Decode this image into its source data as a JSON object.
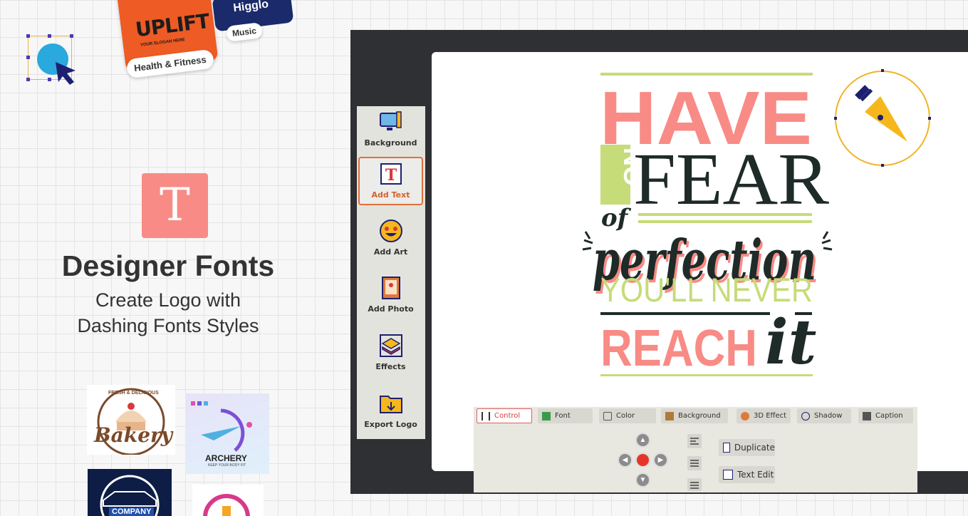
{
  "templates": {
    "uplift_text": "UPLIFT",
    "uplift_sub": "YOUR SLOGAN HERE",
    "health_tag": "Health & Fitness",
    "higglo_text": "Higglo",
    "music_tag": "Music"
  },
  "feature": {
    "icon_letter": "T",
    "title": "Designer Fonts",
    "subtitle_line1": "Create Logo with",
    "subtitle_line2": "Dashing Fonts Styles"
  },
  "samples": {
    "bakery_text": "Bakery",
    "bakery_arc": "FRESH & DELICIOUS",
    "archery_text": "ARCHERY",
    "archery_sub": "KEEP YOUR BODY FIT",
    "car_text": "COMPANY"
  },
  "sidebar": {
    "items": [
      {
        "label": "Background",
        "icon": "monitor-brush-icon"
      },
      {
        "label": "Add Text",
        "icon": "text-frame-icon",
        "active": true
      },
      {
        "label": "Add Art",
        "icon": "emoji-icon"
      },
      {
        "label": "Add Photo",
        "icon": "photo-frame-icon"
      },
      {
        "label": "Effects",
        "icon": "layers-icon"
      },
      {
        "label": "Export Logo",
        "icon": "folder-export-icon"
      }
    ]
  },
  "panel": {
    "tabs": [
      {
        "label": "Control",
        "active": true
      },
      {
        "label": "Font"
      },
      {
        "label": "Color"
      },
      {
        "label": "Background"
      },
      {
        "label": "3D Effect"
      },
      {
        "label": "Shadow"
      },
      {
        "label": "Caption"
      }
    ],
    "duplicate_label": "Duplicate",
    "text_edit_label": "Text Edit"
  },
  "quote": {
    "line1": "HAVE",
    "no": "NO",
    "fear": "FEAR",
    "of": "of",
    "perfection": "perfection",
    "never": "YOU'LL NEVER",
    "reach": "REACH",
    "it": "it"
  },
  "colors": {
    "accent_pink": "#f88b85",
    "accent_green": "#c5dc78",
    "dark_text": "#1e2b28",
    "accent_orange": "#e0713a"
  }
}
